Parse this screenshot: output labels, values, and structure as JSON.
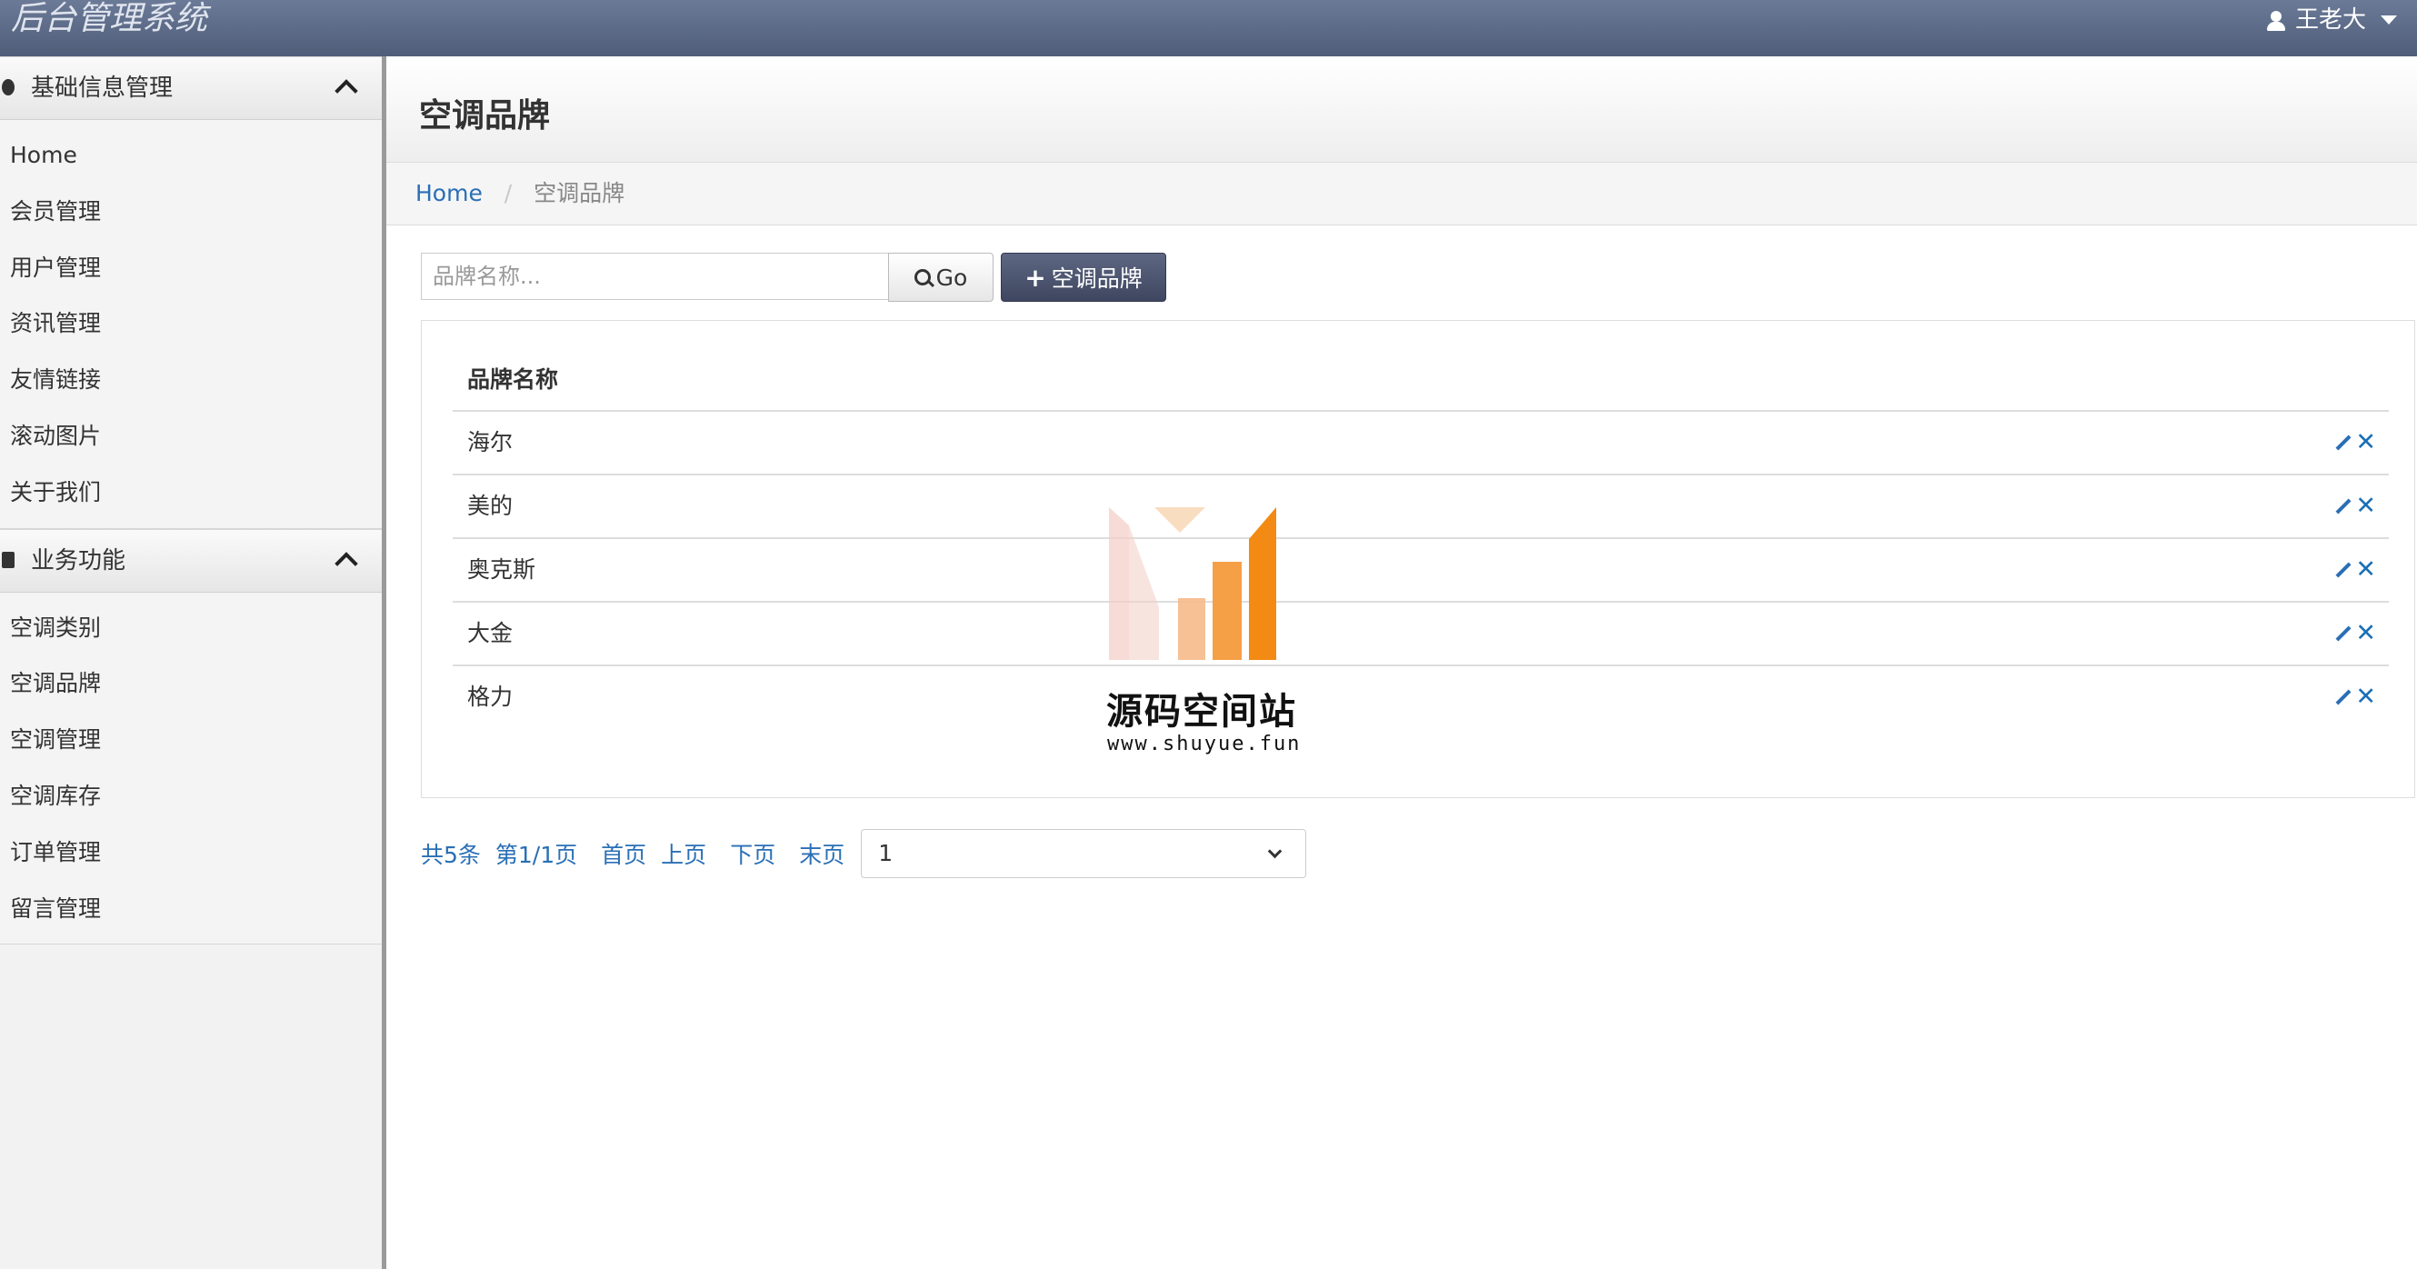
{
  "navbar": {
    "brand": "后台管理系统",
    "user": "王老大"
  },
  "sidebar": {
    "groups": [
      {
        "title": "基础信息管理",
        "items": [
          "Home",
          "会员管理",
          "用户管理",
          "资讯管理",
          "友情链接",
          "滚动图片",
          "关于我们"
        ]
      },
      {
        "title": "业务功能",
        "items": [
          "空调类别",
          "空调品牌",
          "空调管理",
          "空调库存",
          "订单管理",
          "留言管理"
        ]
      }
    ]
  },
  "page": {
    "title": "空调品牌",
    "breadcrumb": {
      "home": "Home",
      "current": "空调品牌"
    }
  },
  "toolbar": {
    "search_placeholder": "品牌名称...",
    "go_label": "Go",
    "add_label": "空调品牌"
  },
  "table": {
    "header": "品牌名称",
    "rows": [
      "海尔",
      "美的",
      "奥克斯",
      "大金",
      "格力"
    ]
  },
  "watermark": {
    "title": "源码空间站",
    "url": "www.shuyue.fun"
  },
  "pager": {
    "total": "共5条",
    "page_info": "第1/1页",
    "first": "首页",
    "prev": "上页",
    "next": "下页",
    "last": "末页",
    "selected_page": "1"
  },
  "colors": {
    "navbar": "#5b6986",
    "link": "#2a6fb5",
    "add_button": "#4a5270"
  }
}
